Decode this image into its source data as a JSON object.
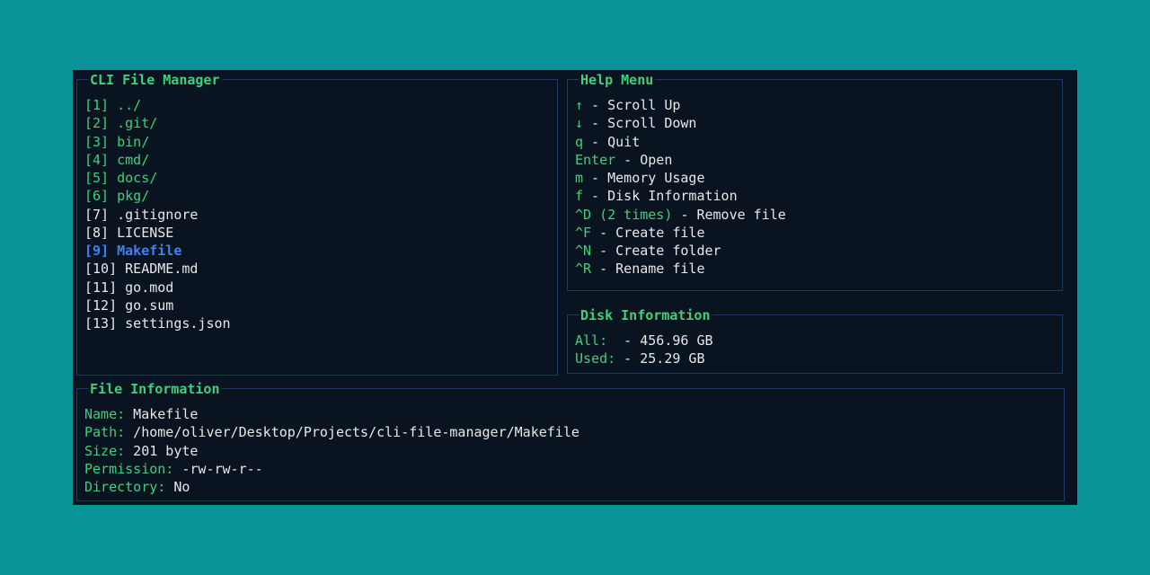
{
  "panels": {
    "fileList": {
      "title": "CLI File Manager"
    },
    "help": {
      "title": "Help Menu"
    },
    "disk": {
      "title": "Disk Information"
    },
    "fileInfo": {
      "title": "File Information"
    }
  },
  "files": [
    {
      "idx": "[1]",
      "name": "../",
      "type": "dir",
      "selected": false
    },
    {
      "idx": "[2]",
      "name": ".git/",
      "type": "dir",
      "selected": false
    },
    {
      "idx": "[3]",
      "name": "bin/",
      "type": "dir",
      "selected": false
    },
    {
      "idx": "[4]",
      "name": "cmd/",
      "type": "dir",
      "selected": false
    },
    {
      "idx": "[5]",
      "name": "docs/",
      "type": "dir",
      "selected": false
    },
    {
      "idx": "[6]",
      "name": "pkg/",
      "type": "dir",
      "selected": false
    },
    {
      "idx": "[7]",
      "name": ".gitignore",
      "type": "file",
      "selected": false
    },
    {
      "idx": "[8]",
      "name": "LICENSE",
      "type": "file",
      "selected": false
    },
    {
      "idx": "[9]",
      "name": "Makefile",
      "type": "file",
      "selected": true
    },
    {
      "idx": "[10]",
      "name": "README.md",
      "type": "file",
      "selected": false
    },
    {
      "idx": "[11]",
      "name": "go.mod",
      "type": "file",
      "selected": false
    },
    {
      "idx": "[12]",
      "name": "go.sum",
      "type": "file",
      "selected": false
    },
    {
      "idx": "[13]",
      "name": "settings.json",
      "type": "file",
      "selected": false
    }
  ],
  "help": [
    {
      "key": "↑",
      "desc": " - Scroll Up"
    },
    {
      "key": "↓",
      "desc": " - Scroll Down"
    },
    {
      "key": "q",
      "desc": " - Quit"
    },
    {
      "key": "Enter",
      "desc": " - Open"
    },
    {
      "key": "m",
      "desc": " - Memory Usage"
    },
    {
      "key": "f",
      "desc": " - Disk Information"
    },
    {
      "key": "^D (2 times)",
      "desc": " - Remove file"
    },
    {
      "key": "^F",
      "desc": " - Create file"
    },
    {
      "key": "^N",
      "desc": " - Create folder"
    },
    {
      "key": "^R",
      "desc": " - Rename file"
    }
  ],
  "disk": {
    "allLabel": "All:",
    "allValue": "  - 456.96 GB",
    "usedLabel": "Used:",
    "usedValue": " - 25.29 GB"
  },
  "fileInfo": {
    "nameLabel": "Name:",
    "nameValue": " Makefile",
    "pathLabel": "Path:",
    "pathValue": " /home/oliver/Desktop/Projects/cli-file-manager/Makefile",
    "sizeLabel": "Size:",
    "sizeValue": " 201 byte",
    "permLabel": "Permission:",
    "permValue": " -rw-rw-r--",
    "dirLabel": "Directory:",
    "dirValue": " No"
  }
}
